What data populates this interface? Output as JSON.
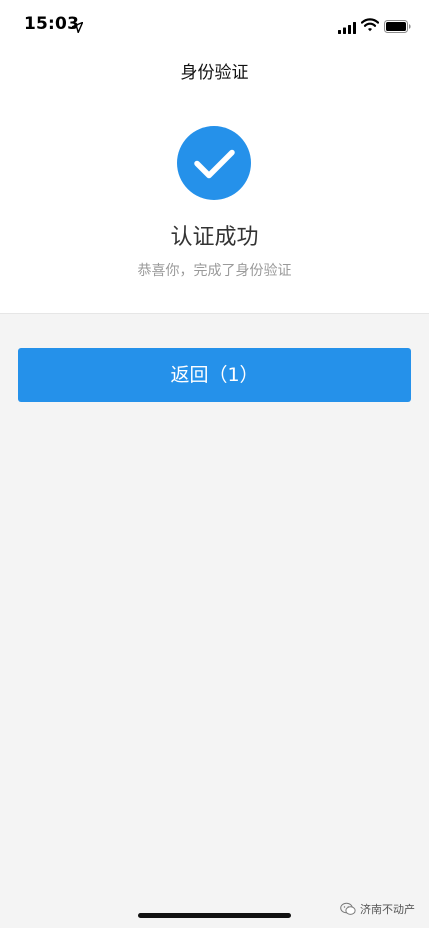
{
  "status_bar": {
    "time": "15:03",
    "icons": [
      "location-arrow-icon",
      "cellular-signal-icon",
      "wifi-icon",
      "battery-icon"
    ]
  },
  "nav": {
    "title": "身份验证"
  },
  "result": {
    "icon": "checkmark-icon",
    "title": "认证成功",
    "subtitle": "恭喜你，完成了身份验证"
  },
  "actions": {
    "back_label": "返回（1）"
  },
  "watermark": {
    "text": "济南不动产"
  },
  "colors": {
    "accent": "#2591ea",
    "background": "#f4f4f4",
    "card": "#ffffff",
    "subtitle": "#9a9a9a"
  }
}
